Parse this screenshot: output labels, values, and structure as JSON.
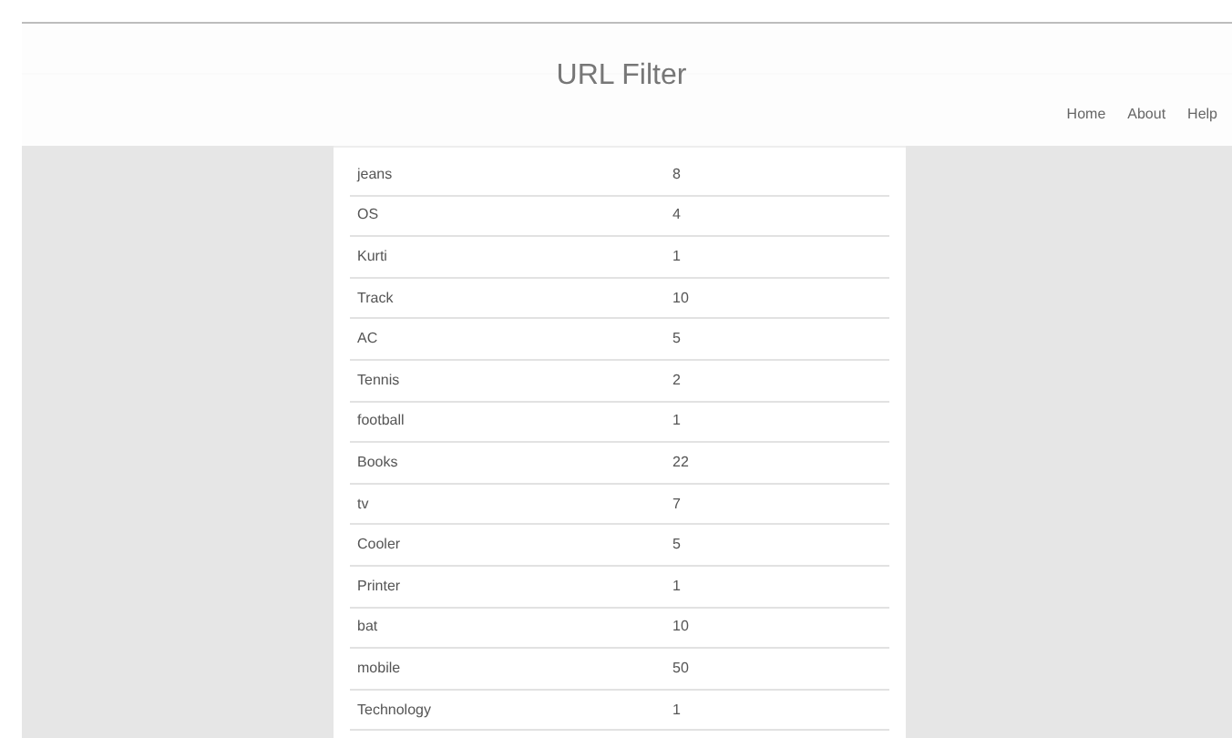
{
  "header": {
    "title": "URL Filter",
    "nav": [
      "Home",
      "About",
      "Help"
    ]
  },
  "table": {
    "rows": [
      {
        "name": "jeans",
        "count": "8"
      },
      {
        "name": "OS",
        "count": "4"
      },
      {
        "name": "Kurti",
        "count": "1"
      },
      {
        "name": "Track",
        "count": "10"
      },
      {
        "name": "AC",
        "count": "5"
      },
      {
        "name": "Tennis",
        "count": "2"
      },
      {
        "name": "football",
        "count": "1"
      },
      {
        "name": "Books",
        "count": "22"
      },
      {
        "name": "tv",
        "count": "7"
      },
      {
        "name": "Cooler",
        "count": "5"
      },
      {
        "name": "Printer",
        "count": "1"
      },
      {
        "name": "bat",
        "count": "10"
      },
      {
        "name": "mobile",
        "count": "50"
      },
      {
        "name": "Technology",
        "count": "1"
      }
    ]
  }
}
